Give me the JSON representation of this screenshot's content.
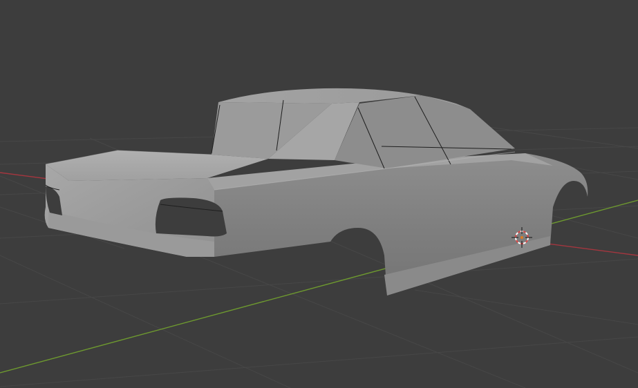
{
  "viewport": {
    "background": "#3d3d3d",
    "grid_color": "#4a4a4a",
    "x_axis_color": "#a5363f",
    "y_axis_color": "#6e9a2f"
  },
  "scene_object": {
    "type": "car-body-mesh",
    "shading": "solid",
    "body_color": "#9c9c9c"
  },
  "cursor_3d": {
    "icon": "3d-cursor-icon",
    "ring_colors": [
      "#d94a4a",
      "#ffffff"
    ]
  }
}
